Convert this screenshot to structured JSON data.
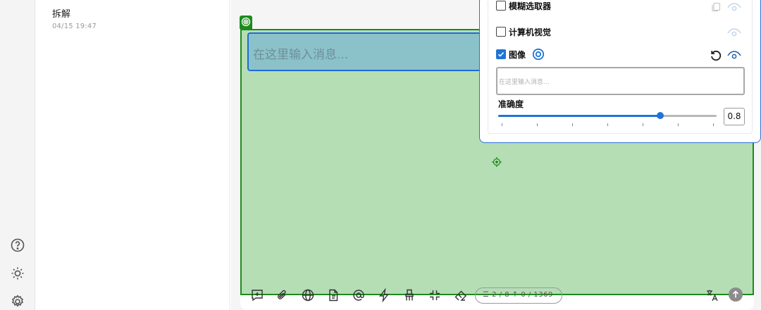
{
  "conversation": {
    "title": "拆解",
    "time": "04/15 19:47"
  },
  "composer": {
    "placeholder": "在这里输入消息...",
    "token_counter": "☰ 2 / 8  ↑ 0 / 1369"
  },
  "panel": {
    "options": [
      {
        "label": "模糊选取器",
        "checked": false
      },
      {
        "label": "计算机视觉",
        "checked": false
      },
      {
        "label": "图像",
        "checked": true
      }
    ],
    "prompt_placeholder": "在这里输入消息...",
    "accuracy": {
      "label": "准确度",
      "value": "0.8",
      "fraction": 0.8
    }
  },
  "colors": {
    "accent": "#1f74d6",
    "root_overlay_border": "#1d8a1d",
    "root_overlay_fill": "#80c680",
    "input_overlay_border": "#1f6cd6"
  },
  "icons": {
    "rail": [
      "help-icon",
      "sun-icon",
      "settings-icon"
    ],
    "toolbar": [
      "new-topic-icon",
      "attachment-icon",
      "web-search-icon",
      "file-icon",
      "mention-icon",
      "quick-phrase-icon",
      "clear-icon",
      "collapse-icon",
      "eraser-icon",
      "translate-icon",
      "send-icon"
    ]
  }
}
